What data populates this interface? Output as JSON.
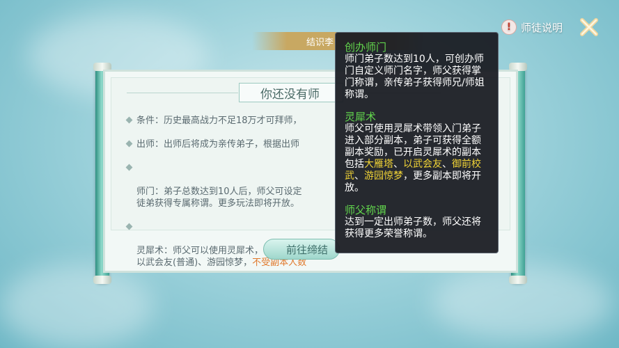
{
  "top_tab": {
    "label": "结识李"
  },
  "help": {
    "label": "师徒说明"
  },
  "panel": {
    "title": "你还没有师",
    "rules": [
      {
        "text": "条件：历史最高战力不足18万才可拜师，"
      },
      {
        "text": "出师：出师后将成为亲传弟子，根据出师"
      },
      {
        "text": "师门：弟子总数达到10人后，师父可设定\n徒弟获得专属称谓。更多玩法即将开放。"
      },
      {
        "text": "灵犀术：师父可以使用灵犀术，带领1个入\n以武会友(普通)、游园惊梦，",
        "warn": "不受副本人数"
      }
    ],
    "button_label": "前往缔结"
  },
  "tooltip": {
    "sections": [
      {
        "title": "创办师门",
        "body": "师门弟子数达到10人，可创办师门自定义师门名字，师父获得掌门称谓，亲传弟子获得师兄/师姐称谓。"
      },
      {
        "title": "灵犀术",
        "body_pre": "师父可使用灵犀术带领入门弟子进入部分副本，弟子可获得全额副本奖励，已开启灵犀术的副本包括",
        "highlights": [
          "大雁塔",
          "以武会友",
          "御前校武",
          "游园惊梦"
        ],
        "separator": "、",
        "body_post": "，更多副本即将开放。"
      },
      {
        "title": "师父称谓",
        "body": "达到一定出师弟子数，师父还将获得更多荣誉称谓。"
      }
    ]
  },
  "colors": {
    "accent_green": "#62d64d",
    "highlight_yellow": "#f1d436",
    "warning_orange": "#e0782b"
  }
}
